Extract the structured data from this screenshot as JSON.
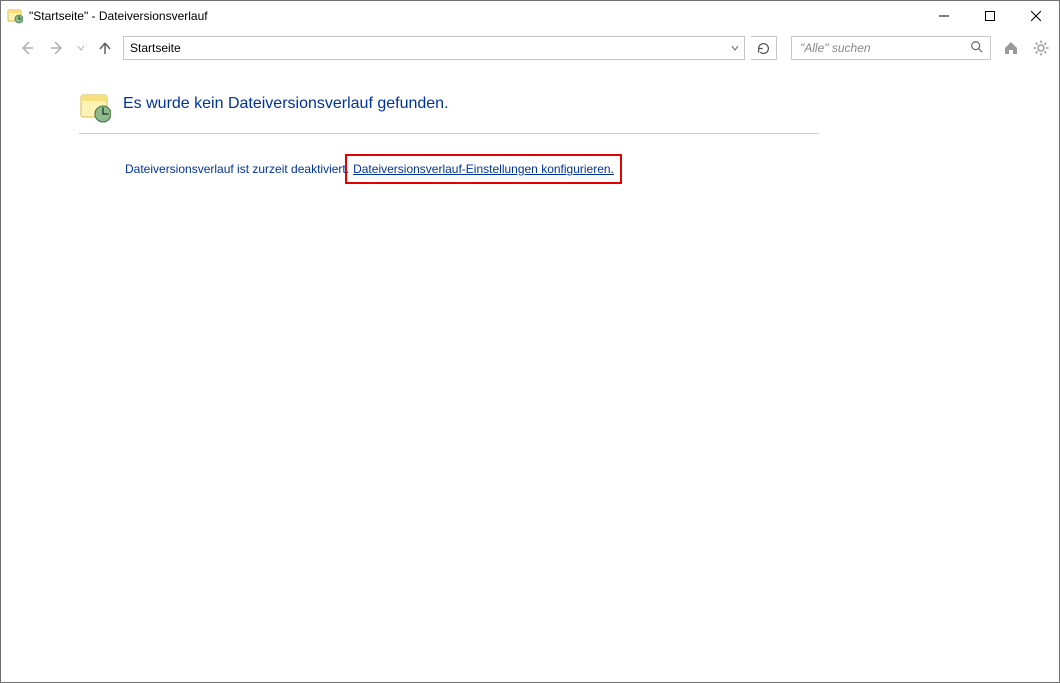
{
  "titlebar": {
    "title": "\"Startseite\" - Dateiversionsverlauf"
  },
  "toolbar": {
    "address": "Startseite",
    "search_placeholder": "\"Alle\" suchen"
  },
  "main": {
    "heading": "Es wurde kein Dateiversionsverlauf gefunden.",
    "status_text": "Dateiversionsverlauf ist zurzeit deaktiviert.",
    "status_link": "Dateiversionsverlauf-Einstellungen konfigurieren."
  }
}
